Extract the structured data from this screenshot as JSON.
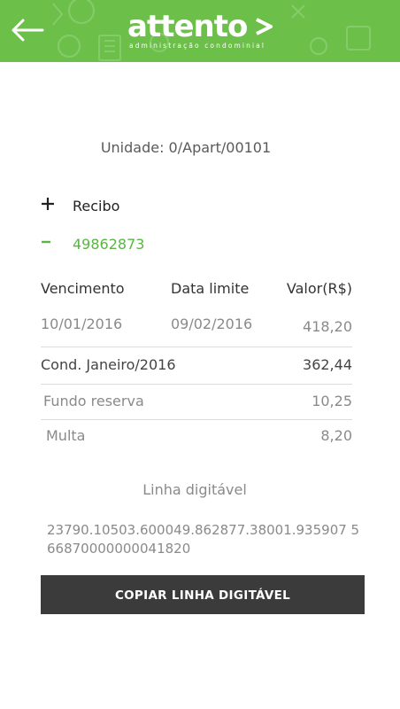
{
  "header": {
    "logo_text": "attento",
    "tagline": "administração condominial",
    "back_icon": "arrow-left-icon",
    "color": "#6cc04a"
  },
  "unit_label": "Unidade: 0/Apart/00101",
  "sections": {
    "recibo": {
      "icon": "plus-icon",
      "label": "Recibo"
    },
    "boleto": {
      "icon": "minus-icon",
      "label": "49862873",
      "color": "#5ab545"
    }
  },
  "table": {
    "headers": {
      "due": "Vencimento",
      "limit": "Data limite",
      "value": "Valor(R$)"
    },
    "main": {
      "due": "10/01/2016",
      "limit": "09/02/2016",
      "value": "418,20"
    },
    "items": [
      {
        "label": "Cond. Janeiro/2016",
        "value": "362,44"
      },
      {
        "label": "Fundo reserva",
        "value": "10,25"
      },
      {
        "label": "Multa",
        "value": "8,20"
      }
    ]
  },
  "linha_digitavel": {
    "title": "Linha digitável",
    "code": "23790.10503.600049.862877.38001.935907 5 66870000000041820"
  },
  "copy_button_label": "COPIAR LINHA DIGITÁVEL"
}
